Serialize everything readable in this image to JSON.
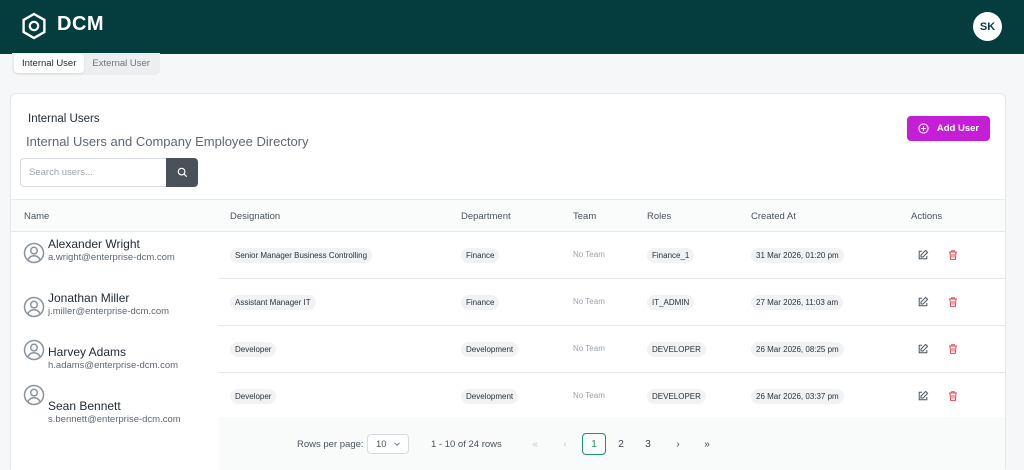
{
  "app": {
    "brand": "DCM",
    "user_initials": "SK"
  },
  "tabs": [
    {
      "label": "Internal User",
      "active": true
    },
    {
      "label": "External User",
      "active": false
    }
  ],
  "card": {
    "title": "Internal Users",
    "subtitle": "Internal Users and Company Employee Directory",
    "add_button": "Add User",
    "search_placeholder": "Search users..."
  },
  "table": {
    "columns": [
      "Name",
      "Designation",
      "Department",
      "Team",
      "Roles",
      "Created At",
      "Actions"
    ],
    "rows": [
      {
        "name": "Alexander Wright",
        "email": "a.wright@enterprise-dcm.com",
        "designation": "Senior Manager Business Controlling",
        "department": "Finance",
        "team": "No Team",
        "role": "Finance_1",
        "created": "31 Mar 2026, 01:20 pm"
      },
      {
        "name": "Jonathan Miller",
        "email": "j.miller@enterprise-dcm.com",
        "designation": "Assistant Manager IT",
        "department": "Finance",
        "team": "No Team",
        "role": "IT_ADMIN",
        "created": "27 Mar 2026, 11:03 am"
      },
      {
        "name": "Harvey Adams",
        "email": "h.adams@enterprise-dcm.com",
        "designation": "Developer",
        "department": "Development",
        "team": "No Team",
        "role": "DEVELOPER",
        "created": "26 Mar 2026, 08:25 pm"
      },
      {
        "name": "Sean Bennett",
        "email": "s.bennett@enterprise-dcm.com",
        "designation": "Developer",
        "department": "Development",
        "team": "No Team",
        "role": "DEVELOPER",
        "created": "26 Mar 2026, 03:37 pm"
      }
    ]
  },
  "pagination": {
    "rows_label": "Rows per page:",
    "rows_value": "10",
    "range": "1 - 10 of 24 rows",
    "first": "«",
    "prev": "‹",
    "pages": [
      "1",
      "2",
      "3"
    ],
    "current_page": "1",
    "next": "›",
    "last": "»"
  },
  "colors": {
    "header_bg": "#053d3f",
    "accent": "#c41fd6",
    "current_page": "#1d8f73",
    "delete_icon": "#e5484d"
  },
  "icons": [
    "hexagon-logo-icon",
    "search-icon",
    "plus-circle-icon",
    "user-circle-icon",
    "edit-icon",
    "trash-icon",
    "chevron-down-icon"
  ]
}
